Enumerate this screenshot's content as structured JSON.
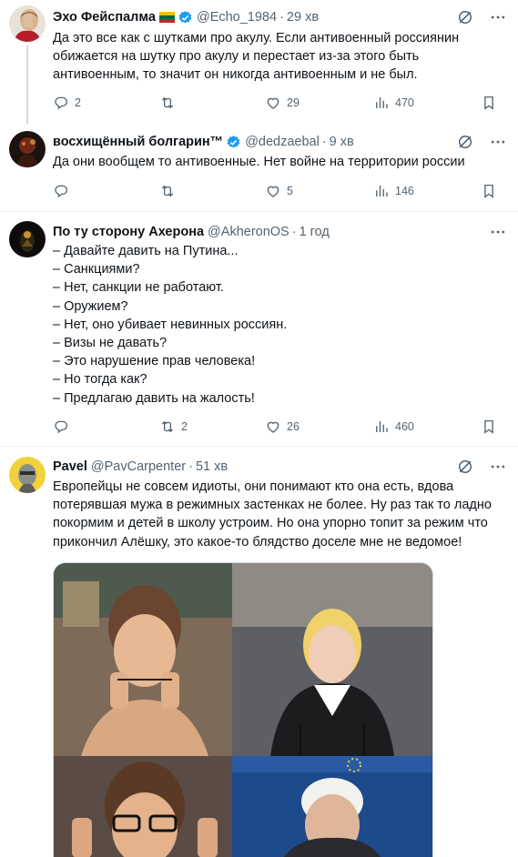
{
  "tweets": [
    {
      "name": "Эхо Фейспалма",
      "handle": "@Echo_1984",
      "time": "29 хв",
      "lines": [
        "Да это все как с шутками про акулу. Если антивоенный россиянин",
        "обижается на шутку про акулу и перестает из-за этого быть",
        "антивоенным, то значит он никогда антивоенным и не был."
      ],
      "replies": "2",
      "retweets": "",
      "likes": "29",
      "views": "470"
    },
    {
      "name": "восхищённый болгарин™",
      "handle": "@dedzaebal",
      "time": "9 хв",
      "lines": [
        "Да они вообщем то антивоенные. Нет войне на территории россии"
      ],
      "replies": "",
      "retweets": "",
      "likes": "5",
      "views": "146"
    },
    {
      "name": "По ту сторону Ахерона",
      "handle": "@AkheronOS",
      "time": "1 год",
      "lines": [
        "– Давайте давить на Путина...",
        "– Санкциями?",
        "– Нет, санкции не работают.",
        "– Оружием?",
        "– Нет, оно убивает невинных россиян.",
        "– Визы не давать?",
        "– Это нарушение прав человека!",
        "– Но тогда как?",
        "– Предлагаю давить на жалость!"
      ],
      "replies": "",
      "retweets": "2",
      "likes": "26",
      "views": "460"
    },
    {
      "name": "Pavel",
      "handle": "@PavCarpenter",
      "time": "51 хв",
      "lines": [
        "Европейцы не совсем идиоты, они понимают кто она есть, вдова",
        "потерявшая мужа в режимных застенках не более. Ну раз так то ладно",
        "покормим и детей в школу устроим. Но она упорно топит за режим что",
        "прикончил Алёшку, это какое-то блядство доселе мне не ведомое!"
      ]
    }
  ],
  "dot_sep": "·",
  "colors": {
    "verified": "#1d9bf0",
    "text": "#0f1419",
    "secondary": "#536471",
    "divider": "#eff3f4",
    "thread_line": "#cfd9de"
  },
  "flag_colors": [
    "#fdb913",
    "#006a44",
    "#c1272d"
  ],
  "icons": [
    "verified-badge-icon",
    "grok-icon",
    "more-icon",
    "reply-icon",
    "retweet-icon",
    "like-icon",
    "views-icon",
    "bookmark-icon"
  ]
}
